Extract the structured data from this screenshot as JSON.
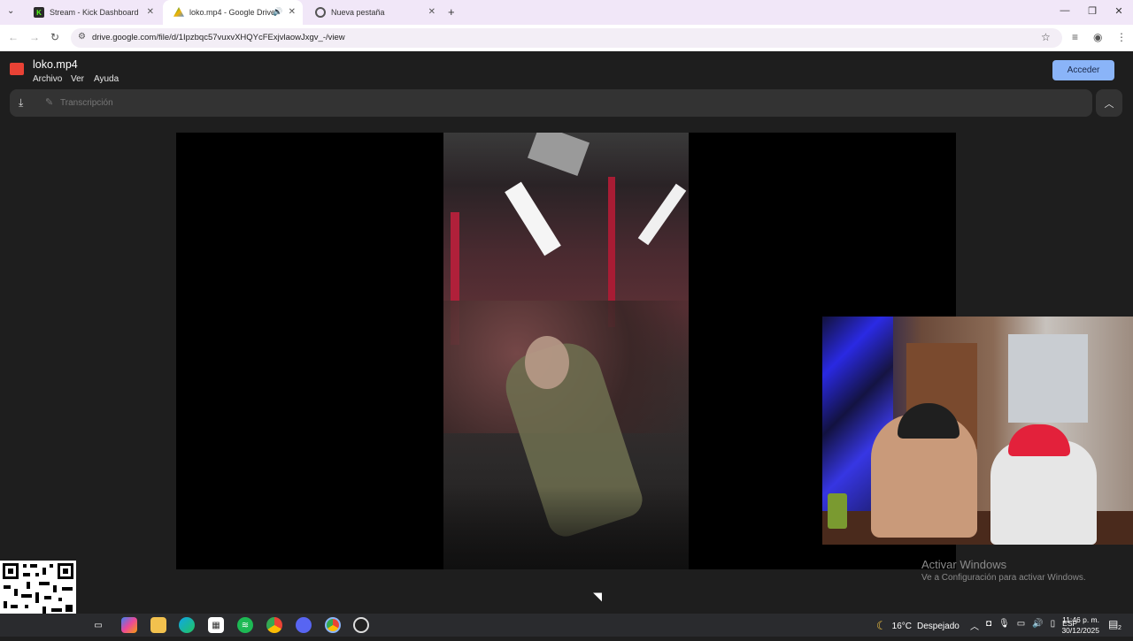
{
  "browser": {
    "tabs": [
      {
        "title": "Stream - Kick Dashboard",
        "icon": "kick-icon",
        "active": false
      },
      {
        "title": "loko.mp4 - Google Drive",
        "icon": "google-drive-icon",
        "active": true,
        "audio": true
      },
      {
        "title": "Nueva pestaña",
        "icon": "chrome-icon",
        "active": false
      }
    ],
    "url": "drive.google.com/file/d/1Ipzbqc57vuxvXHQYcFExjvlaowJxgv_-/view"
  },
  "drive": {
    "file_title": "loko.mp4",
    "menu": [
      "Archivo",
      "Ver",
      "Ayuda"
    ],
    "sign_in_label": "Acceder",
    "transcript_label": "Transcripción"
  },
  "watermark": {
    "line1": "Activar Windows",
    "line2": "Ve a Configuración para activar Windows."
  },
  "taskbar": {
    "weather_temp": "16°C",
    "weather_text": "Despejado",
    "language": "ESP",
    "time": "11:46 p. m.",
    "date": "30/12/2025",
    "notification_count": "2"
  },
  "colors": {
    "accent_button": "#8ab4f8",
    "tabstrip": "#f1e7f8",
    "viewer_bg": "#1e1e1e"
  }
}
